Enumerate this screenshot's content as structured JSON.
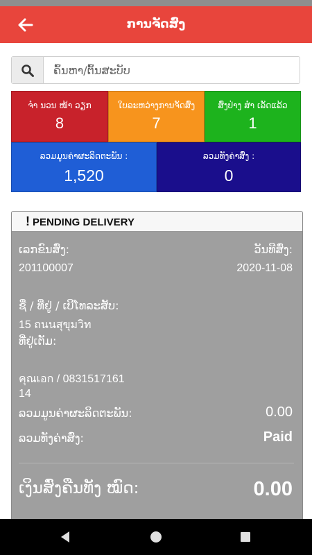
{
  "header": {
    "title": "ການຈັດສົ່ງ",
    "back_icon": "arrow-left-icon"
  },
  "search": {
    "placeholder": "ຄົ້ນຫາ/ຕົ້ນສະບັບ",
    "value": "",
    "icon": "search-icon"
  },
  "stats": [
    {
      "label": "ຈຳ ນວນ ໜ້າ ວຽກ",
      "value": "8",
      "color": "#c8222b"
    },
    {
      "label": "ໃບລະຫວ່າງການຈັດສົ່ງ",
      "value": "7",
      "color": "#f7941d"
    },
    {
      "label": "ສົ່ງປ່າງ ສຳ ເລັດແລ້ວ",
      "value": "1",
      "color": "#1db31d"
    }
  ],
  "totals": [
    {
      "label": "ລວມມູນຄ່າຜະລິດຕະພັນ :",
      "value": "1,520",
      "color": "#1f5ed6"
    },
    {
      "label": "ລວມທັງຄ່າສົ່ງ :",
      "value": "0",
      "color": "#1a0e8c"
    }
  ],
  "order": {
    "status_header": "PENDING DELIVERY",
    "order_no_label": "ເລກຂົນສົ່ງ:",
    "order_no": "201100007",
    "date_label": "ວັນທີສົ່ງ:",
    "date": "2020-11-08",
    "address_label": "ຊື່ / ທີ່ຢູ່ / ເບີໂທລະສັບ:",
    "address_line": "15 ถนนสุขุมวิท",
    "address_extra_label": "ທີ່ຢູ່ເຕັມ:",
    "contact": "คุณเอก / 0831517161",
    "contact_extra": "14",
    "product_total_label": "ລວມມູນຄ່າຜະລິດຕະພັນ:",
    "product_total": "0.00",
    "shipping_label": "ລວມທັງຄ່າສົ່ງ:",
    "shipping_status": "Paid",
    "grand_total_label": "ເງິນສົ່ງຄືນທັງ ໝົດ:",
    "grand_total": "0.00"
  },
  "colors": {
    "app_bar": "#e8453c",
    "card_bg": "#9f9f9f"
  }
}
